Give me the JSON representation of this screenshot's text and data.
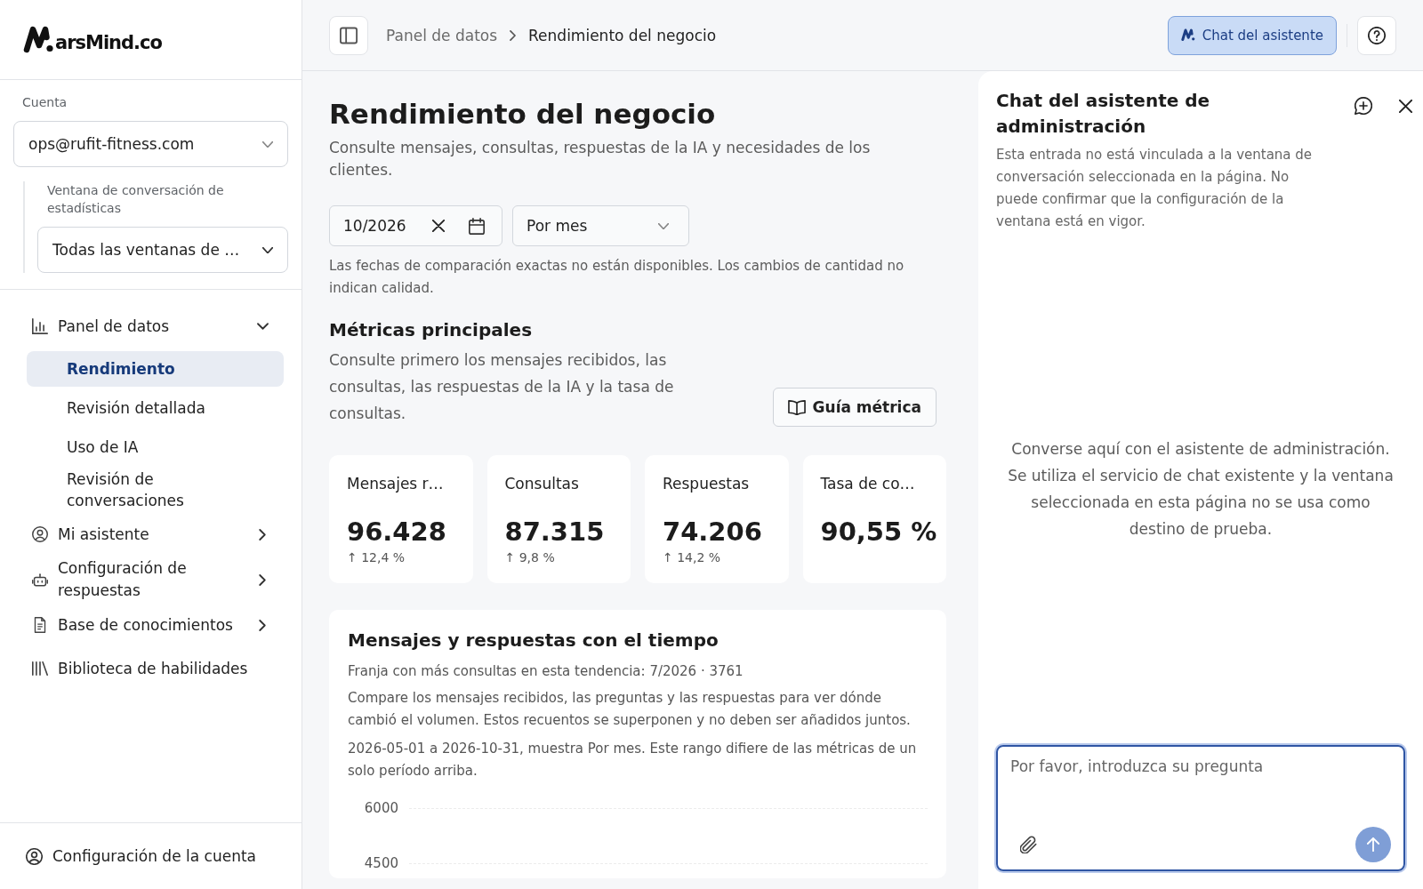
{
  "sidebar": {
    "brand": "arsMind.co",
    "account": {
      "label": "Cuenta",
      "value": "ops@rufit-fitness.com"
    },
    "window_filter": {
      "label": "Ventana de conversación de estadísticas",
      "value": "Todas las ventanas de …"
    },
    "nav": [
      {
        "label": "Panel de datos",
        "expanded": true,
        "children": [
          {
            "label": "Rendimiento",
            "selected": true
          },
          {
            "label": "Revisión detallada",
            "selected": false
          },
          {
            "label": "Uso de IA",
            "selected": false
          },
          {
            "label": "Revisión de conversaciones",
            "selected": false
          }
        ]
      },
      {
        "label": "Mi asistente",
        "expanded": false
      },
      {
        "label": "Configuración de respuestas",
        "expanded": false
      },
      {
        "label": "Base de conocimientos",
        "expanded": false
      },
      {
        "label": "Biblioteca de habilidades"
      }
    ],
    "footer": "Configuración de la cuenta"
  },
  "topbar": {
    "breadcrumb": [
      {
        "label": "Panel de datos"
      },
      {
        "label": "Rendimiento del negocio"
      }
    ],
    "assistant_button": {
      "label": "Chat del asistente",
      "active": true
    }
  },
  "page": {
    "title": "Rendimiento del negocio",
    "subtitle": "Consulte mensajes, consultas, respuestas de la IA y necesidades de los clientes.",
    "date_field": {
      "value": "10/2026"
    },
    "period_select": {
      "value": "Por mes"
    },
    "note": "Las fechas de comparación exactas no están disponibles. Los cambios de cantidad no indican calidad.",
    "metrics_section": {
      "title": "Métricas principales",
      "description": "Consulte primero los mensajes recibidos, las consultas, las respuestas de la IA y la tasa de consultas.",
      "guide_button": "Guía métrica"
    },
    "metrics": [
      {
        "label": "Mensajes r…",
        "value": "96.428",
        "delta": "↑ 12,4 %"
      },
      {
        "label": "Consultas",
        "value": "87.315",
        "delta": "↑ 9,8 %"
      },
      {
        "label": "Respuestas",
        "value": "74.206",
        "delta": "↑ 14,2 %"
      },
      {
        "label": "Tasa de co…",
        "value": "90,55 %"
      }
    ],
    "trend": {
      "title": "Mensajes y respuestas con el tiempo",
      "peak": "Franja con más consultas en esta tendencia: 7/2026 · 3761",
      "description": "Compare los mensajes recibidos, las preguntas y las respuestas para ver dónde cambió el volumen. Estos recuentos se superponen y no deben ser añadidos juntos.",
      "range_note": "2026-05-01 a 2026-10-31, muestra Por mes. Este rango difiere de las métricas de un solo período arriba.",
      "y_tick_labels": [
        "6000",
        "4500"
      ]
    }
  },
  "chat": {
    "title": "Chat del asistente de administración",
    "notice": "Esta entrada no está vinculada a la ventana de conversación seleccionada en la página. No puede confirmar que la configuración de la ventana está en vigor.",
    "empty_message": "Converse aquí con el asistente de administración. Se utiliza el servicio de chat existente y la ventana seleccionada en esta página no se usa como destino de prueba.",
    "composer": {
      "placeholder": "Por favor, introduzca su pregunta",
      "focused": true,
      "send_disabled": true
    }
  }
}
